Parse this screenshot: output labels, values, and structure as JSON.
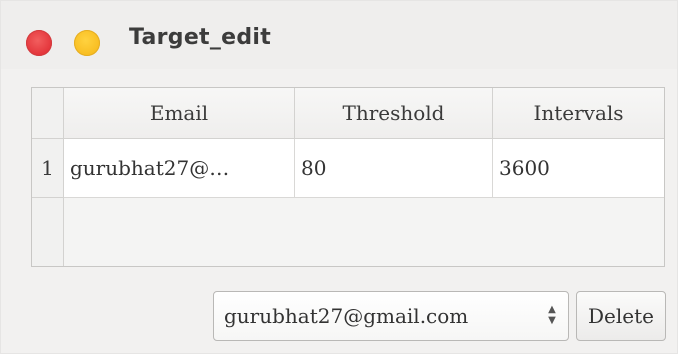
{
  "window": {
    "title": "Target_edit"
  },
  "table": {
    "columns": [
      "Email",
      "Threshold",
      "Intervals"
    ],
    "rows": [
      {
        "num": "1",
        "email": "gurubhat27@…",
        "threshold": "80",
        "intervals": "3600"
      }
    ]
  },
  "controls": {
    "email_select_value": "gurubhat27@gmail.com",
    "delete_label": "Delete"
  }
}
